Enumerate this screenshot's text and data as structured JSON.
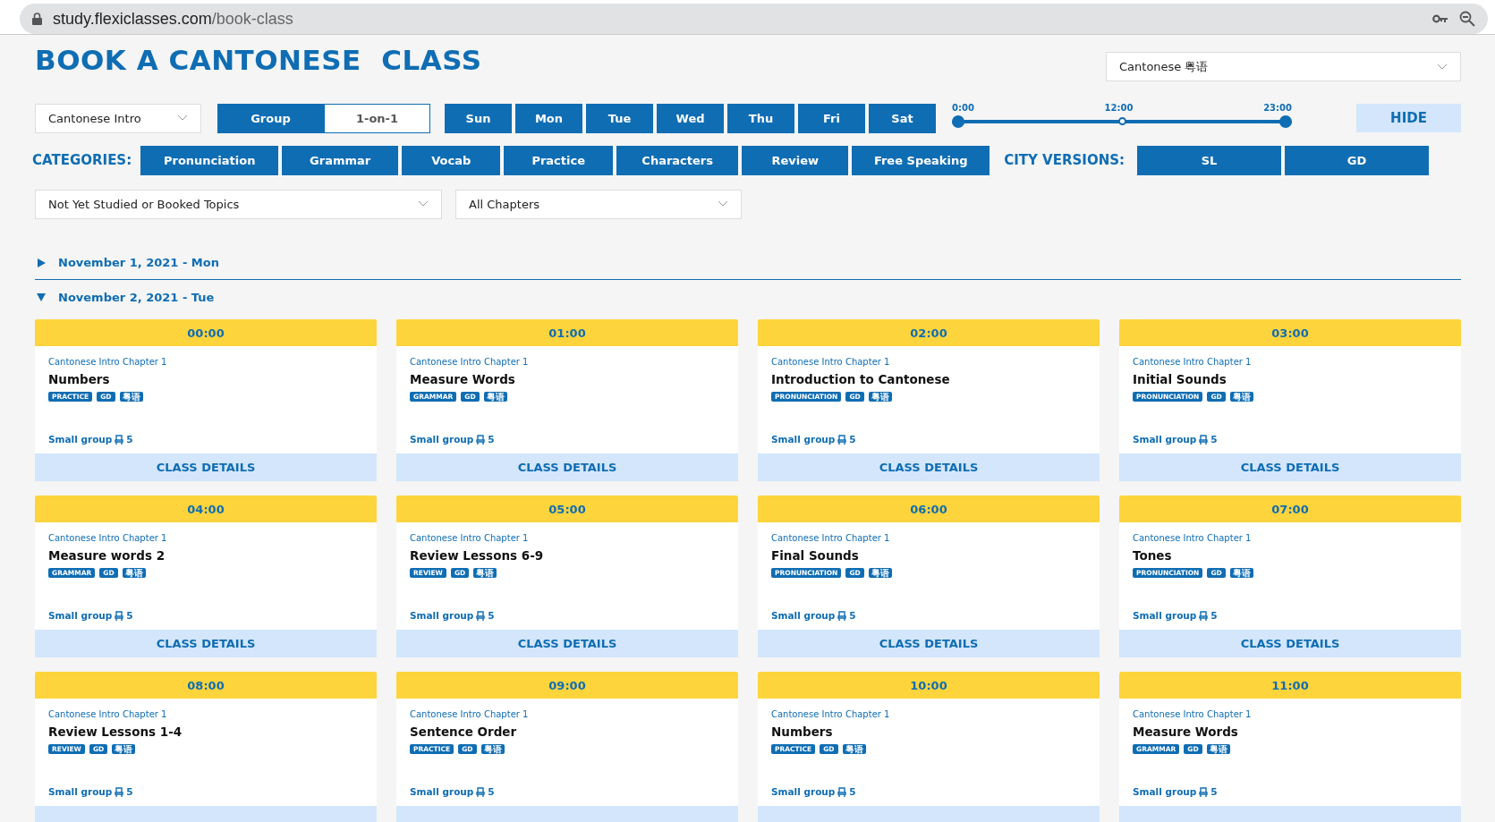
{
  "browser": {
    "url_host": "study.flexiclasses.com",
    "url_path": "/book-class"
  },
  "title": "BOOK A CANTONESE  CLASS",
  "language_select": {
    "value": "Cantonese 粤语"
  },
  "course_select": {
    "value": "Cantonese Intro"
  },
  "class_type": [
    {
      "label": "Group",
      "selected": true
    },
    {
      "label": "1-on-1",
      "selected": false
    }
  ],
  "days": [
    {
      "label": "Sun",
      "selected": true
    },
    {
      "label": "Mon",
      "selected": true
    },
    {
      "label": "Tue",
      "selected": true
    },
    {
      "label": "Wed",
      "selected": true
    },
    {
      "label": "Thu",
      "selected": true
    },
    {
      "label": "Fri",
      "selected": true
    },
    {
      "label": "Sat",
      "selected": true
    }
  ],
  "time_slider": {
    "labels": [
      "0:00",
      "12:00",
      "23:00"
    ],
    "level": 1
  },
  "hide_button": "HIDE",
  "categories_label": "CATEGORIES:",
  "categories": [
    {
      "label": "Pronunciation",
      "selected": true
    },
    {
      "label": "Grammar",
      "selected": true
    },
    {
      "label": "Vocab",
      "selected": true
    },
    {
      "label": "Practice",
      "selected": true
    },
    {
      "label": "Characters",
      "selected": true
    },
    {
      "label": "Review",
      "selected": true
    },
    {
      "label": "Free Speaking",
      "selected": true
    }
  ],
  "city_label": "CITY VERSIONS:",
  "cities": [
    {
      "label": "SL",
      "selected": true
    },
    {
      "label": "GD",
      "selected": true
    }
  ],
  "topic_filter": {
    "value": "Not Yet Studied or Booked Topics"
  },
  "chapter_filter": {
    "value": "All Chapters"
  },
  "dates": [
    {
      "label": "November 1, 2021 - Mon",
      "expanded": false
    },
    {
      "label": "November 2, 2021 - Tue",
      "expanded": true,
      "classes": [
        {
          "time": "00:00",
          "chapter": "Cantonese Intro Chapter 1",
          "title": "Numbers",
          "tags": [
            {
              "text": "PRACTICE",
              "kind": "latin"
            },
            {
              "text": "GD",
              "kind": "latin"
            },
            {
              "text": "粤语",
              "kind": "cjk"
            }
          ],
          "group": "Small group",
          "seats": "5",
          "details": "CLASS DETAILS"
        },
        {
          "time": "01:00",
          "chapter": "Cantonese Intro Chapter 1",
          "title": "Measure Words",
          "tags": [
            {
              "text": "GRAMMAR",
              "kind": "latin"
            },
            {
              "text": "GD",
              "kind": "latin"
            },
            {
              "text": "粤语",
              "kind": "cjk"
            }
          ],
          "group": "Small group",
          "seats": "5",
          "details": "CLASS DETAILS"
        },
        {
          "time": "02:00",
          "chapter": "Cantonese Intro Chapter 1",
          "title": "Introduction to Cantonese",
          "tags": [
            {
              "text": "PRONUNCIATION",
              "kind": "latin"
            },
            {
              "text": "GD",
              "kind": "latin"
            },
            {
              "text": "粤语",
              "kind": "cjk"
            }
          ],
          "group": "Small group",
          "seats": "5",
          "details": "CLASS DETAILS"
        },
        {
          "time": "03:00",
          "chapter": "Cantonese Intro Chapter 1",
          "title": "Initial Sounds",
          "tags": [
            {
              "text": "PRONUNCIATION",
              "kind": "latin"
            },
            {
              "text": "GD",
              "kind": "latin"
            },
            {
              "text": "粤语",
              "kind": "cjk"
            }
          ],
          "group": "Small group",
          "seats": "5",
          "details": "CLASS DETAILS"
        },
        {
          "time": "04:00",
          "chapter": "Cantonese Intro Chapter 1",
          "title": "Measure words 2",
          "tags": [
            {
              "text": "GRAMMAR",
              "kind": "latin"
            },
            {
              "text": "GD",
              "kind": "latin"
            },
            {
              "text": "粤语",
              "kind": "cjk"
            }
          ],
          "group": "Small group",
          "seats": "5",
          "details": "CLASS DETAILS"
        },
        {
          "time": "05:00",
          "chapter": "Cantonese Intro Chapter 1",
          "title": "Review Lessons 6-9",
          "tags": [
            {
              "text": "REVIEW",
              "kind": "latin"
            },
            {
              "text": "GD",
              "kind": "latin"
            },
            {
              "text": "粤语",
              "kind": "cjk"
            }
          ],
          "group": "Small group",
          "seats": "5",
          "details": "CLASS DETAILS"
        },
        {
          "time": "06:00",
          "chapter": "Cantonese Intro Chapter 1",
          "title": "Final Sounds",
          "tags": [
            {
              "text": "PRONUNCIATION",
              "kind": "latin"
            },
            {
              "text": "GD",
              "kind": "latin"
            },
            {
              "text": "粤语",
              "kind": "cjk"
            }
          ],
          "group": "Small group",
          "seats": "5",
          "details": "CLASS DETAILS"
        },
        {
          "time": "07:00",
          "chapter": "Cantonese Intro Chapter 1",
          "title": "Tones",
          "tags": [
            {
              "text": "PRONUNCIATION",
              "kind": "latin"
            },
            {
              "text": "GD",
              "kind": "latin"
            },
            {
              "text": "粤语",
              "kind": "cjk"
            }
          ],
          "group": "Small group",
          "seats": "5",
          "details": "CLASS DETAILS"
        },
        {
          "time": "08:00",
          "chapter": "Cantonese Intro Chapter 1",
          "title": "Review Lessons 1-4",
          "tags": [
            {
              "text": "REVIEW",
              "kind": "latin"
            },
            {
              "text": "GD",
              "kind": "latin"
            },
            {
              "text": "粤语",
              "kind": "cjk"
            }
          ],
          "group": "Small group",
          "seats": "5"
        },
        {
          "time": "09:00",
          "chapter": "Cantonese Intro Chapter 1",
          "title": "Sentence Order",
          "tags": [
            {
              "text": "PRACTICE",
              "kind": "latin"
            },
            {
              "text": "GD",
              "kind": "latin"
            },
            {
              "text": "粤语",
              "kind": "cjk"
            }
          ],
          "group": "Small group",
          "seats": "5"
        },
        {
          "time": "10:00",
          "chapter": "Cantonese Intro Chapter 1",
          "title": "Numbers",
          "tags": [
            {
              "text": "PRACTICE",
              "kind": "latin"
            },
            {
              "text": "GD",
              "kind": "latin"
            },
            {
              "text": "粤语",
              "kind": "cjk"
            }
          ],
          "group": "Small group",
          "seats": "5"
        },
        {
          "time": "11:00",
          "chapter": "Cantonese Intro Chapter 1",
          "title": "Measure Words",
          "tags": [
            {
              "text": "GRAMMAR",
              "kind": "latin"
            },
            {
              "text": "GD",
              "kind": "latin"
            },
            {
              "text": "粤语",
              "kind": "cjk"
            }
          ],
          "group": "Small group",
          "seats": "5"
        }
      ]
    }
  ]
}
